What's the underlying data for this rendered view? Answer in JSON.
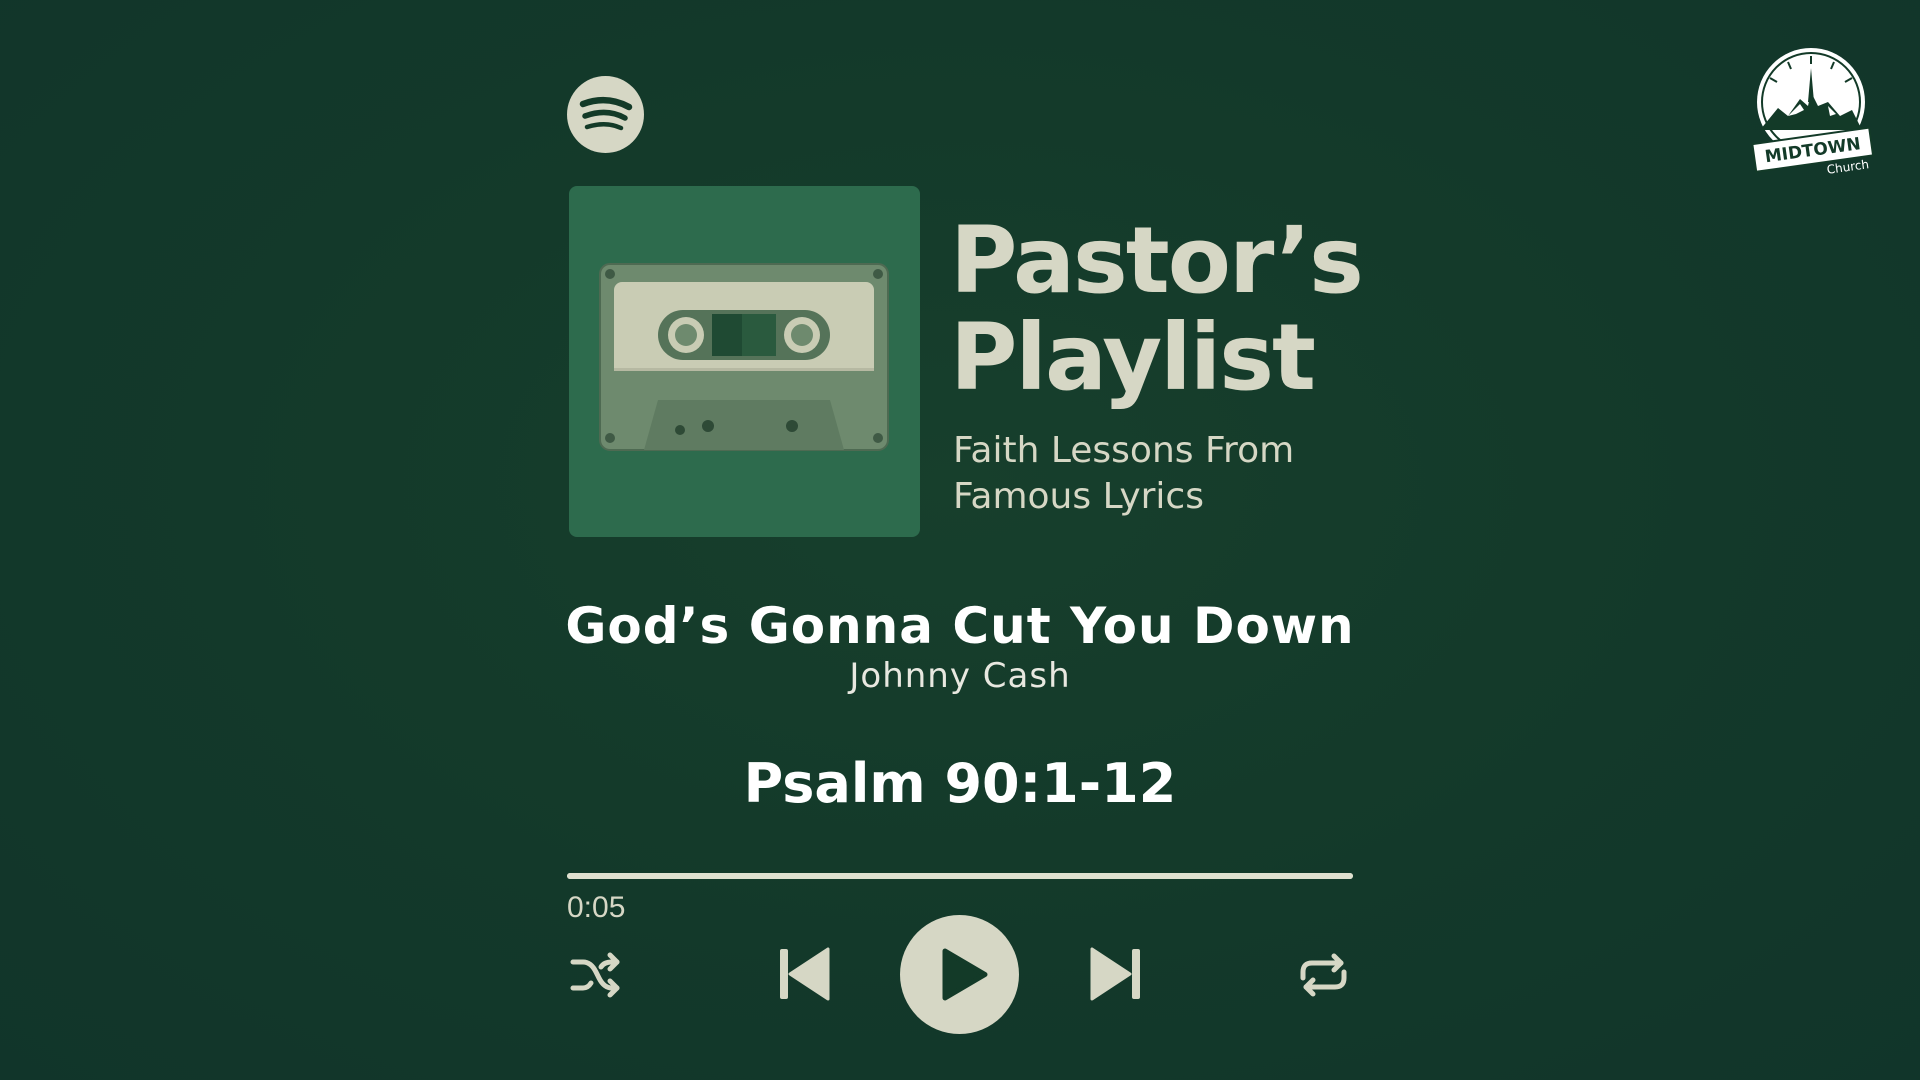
{
  "colors": {
    "background": "#133a28",
    "accent": "#d6d7c5",
    "album_bg": "#2d6b4d",
    "text_white": "#ffffff"
  },
  "branding": {
    "app_icon": "spotify-icon",
    "church_logo_top": "MIDTOWN",
    "church_logo_bottom": "Church"
  },
  "playlist": {
    "title_line1": "Pastor’s",
    "title_line2": "Playlist",
    "subtitle_line1": "Faith Lessons From",
    "subtitle_line2": "Famous Lyrics",
    "cover_icon": "cassette-tape-icon"
  },
  "track": {
    "title": "God’s Gonna Cut You Down",
    "artist": "Johnny Cash"
  },
  "scripture": "Psalm 90:1-12",
  "player": {
    "elapsed": "0:05",
    "progress_fraction": 1.0,
    "controls": [
      "shuffle-icon",
      "previous-icon",
      "play-icon",
      "next-icon",
      "repeat-icon"
    ]
  }
}
